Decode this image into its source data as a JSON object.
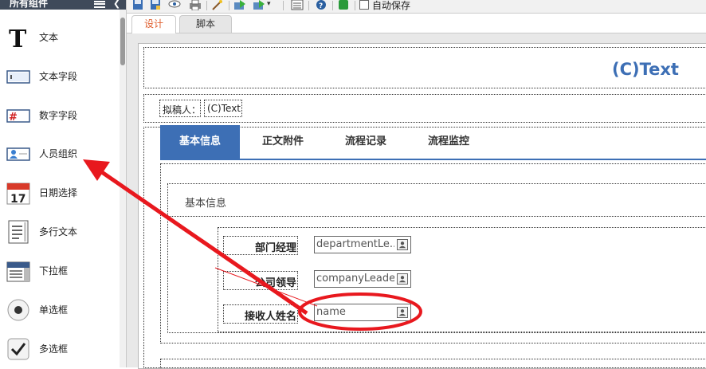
{
  "sidebar": {
    "header": "所有组件",
    "items": [
      {
        "label": "文本",
        "icon": "text-t-icon"
      },
      {
        "label": "文本字段",
        "icon": "text-field-icon"
      },
      {
        "label": "数字字段",
        "icon": "number-field-icon"
      },
      {
        "label": "人员组织",
        "icon": "person-org-icon"
      },
      {
        "label": "日期选择",
        "icon": "calendar-icon"
      },
      {
        "label": "多行文本",
        "icon": "multiline-text-icon"
      },
      {
        "label": "下拉框",
        "icon": "dropdown-icon"
      },
      {
        "label": "单选框",
        "icon": "radio-icon"
      },
      {
        "label": "多选框",
        "icon": "checkbox-icon"
      }
    ]
  },
  "toolbar": {
    "icons": [
      "save-icon",
      "save-as-icon",
      "preview-eye-icon",
      "print-icon",
      "magic-wand-icon",
      "import-icon",
      "export-icon",
      "properties-icon",
      "help-icon",
      "green-app-icon"
    ],
    "autosave_label": "自动保存",
    "autosave_checked": false
  },
  "tabs": [
    {
      "label": "设计",
      "active": true
    },
    {
      "label": "脚本",
      "active": false
    }
  ],
  "form": {
    "title": "(C)Text",
    "drafter_label": "拟稿人：",
    "drafter_value": "(C)Text",
    "doc_tabs": [
      {
        "label": "基本信息",
        "active": true
      },
      {
        "label": "正文附件",
        "active": false
      },
      {
        "label": "流程记录",
        "active": false
      },
      {
        "label": "流程监控",
        "active": false
      }
    ],
    "section_title": "基本信息",
    "fields": [
      {
        "label": "部门经理",
        "value": "departmentLe..."
      },
      {
        "label": "公司领导",
        "value": "companyLeader"
      },
      {
        "label": "接收人姓名",
        "value": "name"
      }
    ]
  },
  "colors": {
    "accent": "#3d6fb5",
    "annotation": "#e8181e",
    "active_tab_text": "#e06030"
  }
}
